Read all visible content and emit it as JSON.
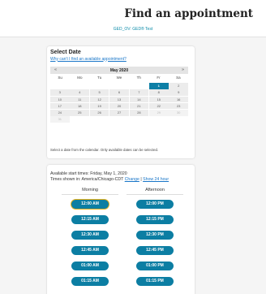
{
  "header": {
    "title": "Find an appointment",
    "exam_link": "GED_OV: GED® Test"
  },
  "select_date": {
    "title": "Select Date",
    "cant_find_link": "Why can't I find an available appointment?",
    "calendar": {
      "month_label": "May 2020",
      "prev_icon": "«",
      "next_icon": "»",
      "weekdays": [
        "Su",
        "Mo",
        "Tu",
        "We",
        "Th",
        "Fr",
        "Sa"
      ],
      "selected_day": "1",
      "weeks": [
        [
          "",
          "",
          "",
          "",
          "",
          "1",
          "2"
        ],
        [
          "3",
          "4",
          "5",
          "6",
          "7",
          "8",
          "9"
        ],
        [
          "10",
          "11",
          "12",
          "13",
          "14",
          "15",
          "16"
        ],
        [
          "17",
          "18",
          "19",
          "20",
          "21",
          "22",
          "23"
        ],
        [
          "24",
          "25",
          "26",
          "27",
          "28",
          "29",
          "30"
        ],
        [
          "31",
          "",
          "",
          "",
          "",
          "",
          ""
        ]
      ],
      "unavailable_days": [
        "29",
        "30",
        "31"
      ]
    },
    "note": "Select a date from the calendar. Only available dates can be selected."
  },
  "times": {
    "available_label": "Available start times: Friday, May 1, 2020",
    "tz_prefix": "Times shown in: America/Chicago-CDT",
    "change_link": "Change",
    "separator": "|",
    "show24_link": "Show 24 hour",
    "morning_label": "Morning",
    "afternoon_label": "Afternoon",
    "morning": [
      "12:00 AM",
      "12:15 AM",
      "12:30 AM",
      "12:45 AM",
      "01:00 AM",
      "01:15 AM"
    ],
    "afternoon": [
      "12:00 PM",
      "12:15 PM",
      "12:30 PM",
      "12:45 PM",
      "01:00 PM",
      "01:15 PM"
    ]
  },
  "colors": {
    "accent": "#0c7ea3",
    "link": "#1976c8",
    "focus_ring": "#e7b21b"
  }
}
